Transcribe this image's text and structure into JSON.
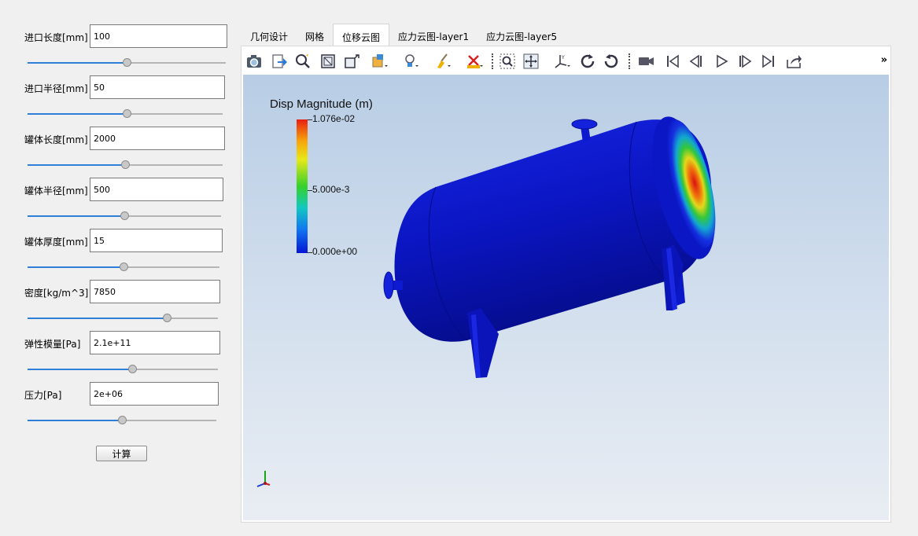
{
  "params": [
    {
      "label": "进口长度[mm]",
      "value": "100",
      "slider": 0.5
    },
    {
      "label": "进口半径[mm]",
      "value": "50",
      "slider": 0.51
    },
    {
      "label": "罐体长度[mm]",
      "value": "2000",
      "slider": 0.5
    },
    {
      "label": "罐体半径[mm]",
      "value": "500",
      "slider": 0.5
    },
    {
      "label": "罐体厚度[mm]",
      "value": "15",
      "slider": 0.5
    },
    {
      "label": "密度[kg/m^3]",
      "value": "7850",
      "slider": 0.73
    },
    {
      "label": "弹性模量[Pa]",
      "value": "2.1e+11",
      "slider": 0.55
    },
    {
      "label": "压力[Pa]",
      "value": "2e+06",
      "slider": 0.5
    }
  ],
  "calc_button": "计算",
  "tabs": [
    {
      "label": "几何设计"
    },
    {
      "label": "网格"
    },
    {
      "label": "位移云图",
      "active": true
    },
    {
      "label": "应力云图-layer1"
    },
    {
      "label": "应力云图-layer5"
    }
  ],
  "toolbar": {
    "icons": [
      "camera-icon",
      "export-icon",
      "zoom-select-icon",
      "reset-view-icon",
      "box-icon",
      "object-dropdown-icon",
      "light-dropdown-icon",
      "broom-dropdown-icon",
      "ruler-dropdown-icon",
      "zoom-to-fit-icon",
      "pan-icon",
      "axes-dropdown-icon",
      "rotate-cw-icon",
      "rotate-ccw-icon",
      "video-icon",
      "first-frame-icon",
      "prev-frame-icon",
      "play-icon",
      "next-frame-icon",
      "last-frame-icon",
      "share-icon"
    ],
    "more": "»"
  },
  "legend": {
    "title": "Disp Magnitude (m)",
    "max": "1.076e-02",
    "mid": "5.000e-3",
    "min": "0.000e+00"
  },
  "colors": {
    "accent": "#2f7ed8",
    "background": "#f0f0f0",
    "tank": "#0a14c8"
  }
}
